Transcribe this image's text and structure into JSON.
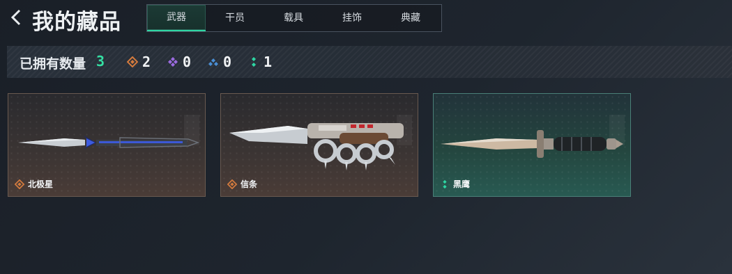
{
  "header": {
    "title": "我的藏品",
    "tabs": [
      {
        "label": "武器",
        "active": true
      },
      {
        "label": "干员",
        "active": false
      },
      {
        "label": "载具",
        "active": false
      },
      {
        "label": "挂饰",
        "active": false
      },
      {
        "label": "典藏",
        "active": false
      }
    ]
  },
  "stats": {
    "owned_label": "已拥有数量",
    "owned_count": "3",
    "rarities": [
      {
        "icon": "orange-diamond-icon",
        "color": "#d27a3e",
        "count": "2"
      },
      {
        "icon": "purple-diamond-cluster-icon",
        "color": "#9b6be0",
        "count": "0"
      },
      {
        "icon": "blue-diamond-pair-icon",
        "color": "#4a8fd6",
        "count": "0"
      },
      {
        "icon": "green-dots-icon",
        "color": "#2ed6a3",
        "count": "1"
      }
    ]
  },
  "items": [
    {
      "name": "北极星",
      "rarity": "orange",
      "icon": "orange-diamond-icon"
    },
    {
      "name": "信条",
      "rarity": "orange",
      "icon": "orange-diamond-icon"
    },
    {
      "name": "黑鹰",
      "rarity": "green",
      "icon": "green-dots-icon"
    }
  ],
  "colors": {
    "accent": "#2ed6a3",
    "orange": "#d27a3e",
    "purple": "#9b6be0",
    "blue": "#4a8fd6"
  }
}
